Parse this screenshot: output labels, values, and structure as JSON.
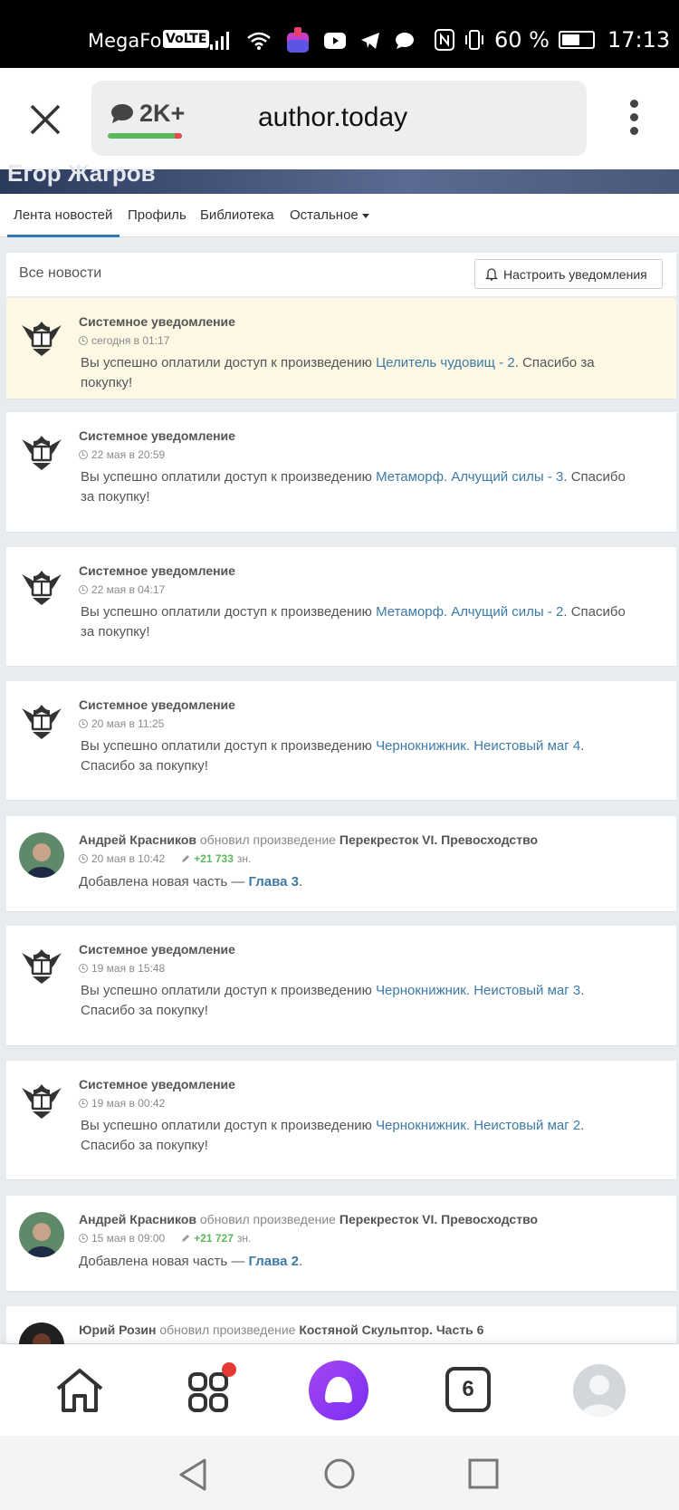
{
  "status_bar": {
    "carrier": "MegaFon",
    "volte": "VoLTE",
    "battery_percent": "60 %",
    "battery_level": 0.6,
    "time": "17:13"
  },
  "browser": {
    "comment_count": "2K+",
    "domain": "author.today"
  },
  "profile": {
    "name": "Егор Жагров"
  },
  "nav": {
    "tabs": [
      "Лента новостей",
      "Профиль",
      "Библиотека",
      "Остальное"
    ]
  },
  "feed": {
    "title": "Все новости",
    "notify_button": "Настроить уведомления"
  },
  "cards": [
    {
      "type": "system",
      "highlight": true,
      "title": "Системное уведомление",
      "time": "сегодня в 01:17",
      "pre": "Вы успешно оплатили доступ к произведению ",
      "link": "Целитель чудовищ - 2",
      "post": ". Спасибо за покупку!"
    },
    {
      "type": "system",
      "title": "Системное уведомление",
      "time": "22 мая в 20:59",
      "pre": "Вы успешно оплатили доступ к произведению ",
      "link": "Метаморф. Алчущий силы - 3",
      "post": ". Спасибо за покупку!"
    },
    {
      "type": "system",
      "title": "Системное уведомление",
      "time": "22 мая в 04:17",
      "pre": "Вы успешно оплатили доступ к произведению ",
      "link": "Метаморф. Алчущий силы - 2",
      "post": ". Спасибо за покупку!"
    },
    {
      "type": "system",
      "title": "Системное уведомление",
      "time": "20 мая в 11:25",
      "pre": "Вы успешно оплатили доступ к произведению ",
      "link": "Чернокнижник. Неистовый маг 4",
      "post": ". Спасибо за покупку!"
    },
    {
      "type": "update",
      "author": "Андрей Красников",
      "action": " обновил произведение ",
      "work": "Перекресток VI. Превосходство",
      "time": "20 мая в 10:42",
      "chars": "+21 733",
      "chars_unit": "зн.",
      "pre": "Добавлена новая часть — ",
      "link": "Глава 3",
      "post": "."
    },
    {
      "type": "system",
      "title": "Системное уведомление",
      "time": "19 мая в 15:48",
      "pre": "Вы успешно оплатили доступ к произведению ",
      "link": "Чернокнижник. Неистовый маг 3",
      "post": ". Спасибо за покупку!"
    },
    {
      "type": "system",
      "title": "Системное уведомление",
      "time": "19 мая в 00:42",
      "pre": "Вы успешно оплатили доступ к произведению ",
      "link": "Чернокнижник. Неистовый маг 2",
      "post": ". Спасибо за покупку!"
    },
    {
      "type": "update",
      "author": "Андрей Красников",
      "action": " обновил произведение ",
      "work": "Перекресток VI. Превосходство",
      "time": "15 мая в 09:00",
      "chars": "+21 727",
      "chars_unit": "зн.",
      "pre": "Добавлена новая часть — ",
      "link": "Глава 2",
      "post": "."
    },
    {
      "type": "update",
      "partial": true,
      "author": "Юрий Розин",
      "action": " обновил произведение ",
      "work": "Костяной Скульптор. Часть 6"
    }
  ],
  "bottom_nav": {
    "tabs_count": "6",
    "icons": [
      "home-icon",
      "apps-icon",
      "alice-icon",
      "tabs-icon",
      "profile-icon"
    ]
  },
  "colors": {
    "link": "#3d7aa6",
    "highlight": "#fcf8e3",
    "alice": "#8a3ff0",
    "green": "#5cb85c"
  }
}
